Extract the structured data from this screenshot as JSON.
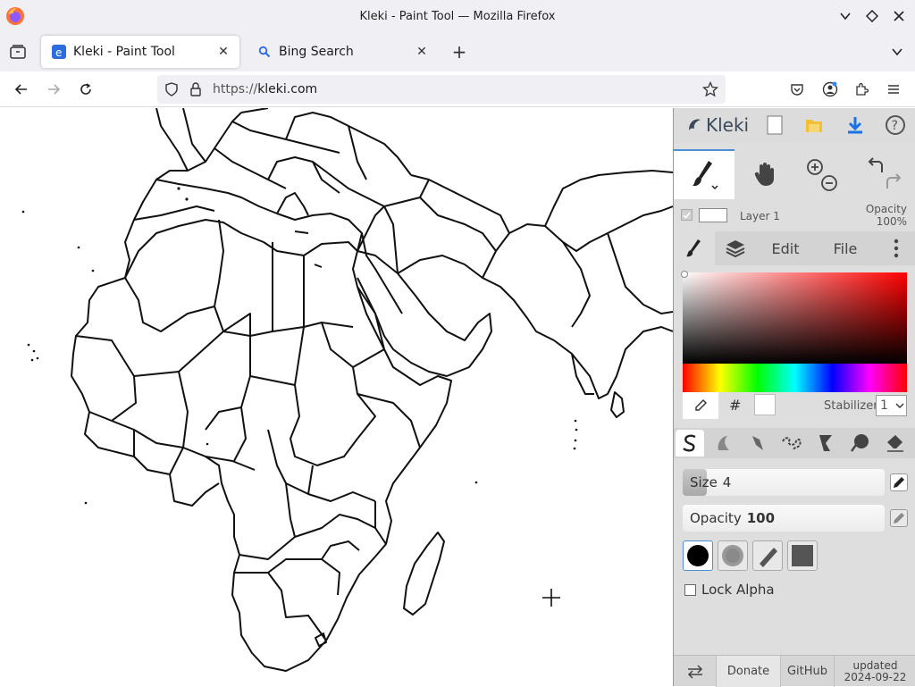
{
  "window": {
    "title": "Kleki - Paint Tool — Mozilla Firefox"
  },
  "tabs": [
    {
      "label": "Kleki - Paint Tool",
      "active": true
    },
    {
      "label": "Bing Search",
      "active": false
    }
  ],
  "navbar": {
    "url_prefix": "https://",
    "url_host": "kleki.com"
  },
  "kleki": {
    "logo": "Kleki",
    "layer": {
      "name": "Layer 1",
      "opacity_label": "Opacity",
      "opacity_value": "100%"
    },
    "panel_tabs": {
      "edit": "Edit",
      "file": "File"
    },
    "color_tools": {
      "hash": "#",
      "stabilizer_label": "Stabilizer",
      "stabilizer_value": "1"
    },
    "size": {
      "label": "Size",
      "value": "4",
      "fraction": 0.12
    },
    "opacity": {
      "label": "Opacity",
      "value": "100"
    },
    "lock_alpha": "Lock Alpha",
    "footer": {
      "donate": "Donate",
      "github": "GitHub",
      "updated_label": "updated",
      "updated_date": "2024-09-22"
    }
  }
}
